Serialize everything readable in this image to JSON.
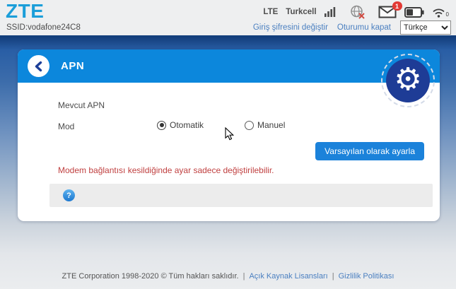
{
  "header": {
    "logo": "ZTE",
    "ssid": "SSID:vodafone24C8",
    "network_type": "LTE",
    "carrier": "Turkcell",
    "message_badge": "1",
    "wifi_client_count": "0",
    "status_icons": [
      "signal-bars-icon",
      "globe-offline-icon",
      "message-icon",
      "battery-icon",
      "wifi-icon"
    ],
    "links": {
      "change_password": "Giriş şifresini değiştir",
      "logout": "Oturumu kapat"
    },
    "language": "Türkçe"
  },
  "panel": {
    "title": "APN",
    "current_apn_label": "Mevcut APN",
    "mode_label": "Mod",
    "mode_options": [
      {
        "label": "Otomatik",
        "selected": true
      },
      {
        "label": "Manuel",
        "selected": false
      }
    ],
    "set_default_button": "Varsayılan olarak ayarla",
    "warning": "Modem bağlantısı kesildiğinde ayar sadece değiştirilebilir.",
    "help_icon": "?"
  },
  "footer": {
    "copyright": "ZTE Corporation 1998-2020 © Tüm hakları saklıdır.",
    "separator": "|",
    "link_open_source": "Açık Kaynak Lisansları",
    "link_privacy": "Gizlilik Politikası"
  },
  "colors": {
    "panel_header_blue": "#0c87dc",
    "gear_circle_blue": "#1e3c96",
    "button_blue": "#1b82da",
    "warning_red": "#c04040",
    "badge_red": "#e23a35",
    "link_blue": "#4a7fc0",
    "logo_blue": "#1b9ed9",
    "gradient_top": "#143f7d"
  }
}
